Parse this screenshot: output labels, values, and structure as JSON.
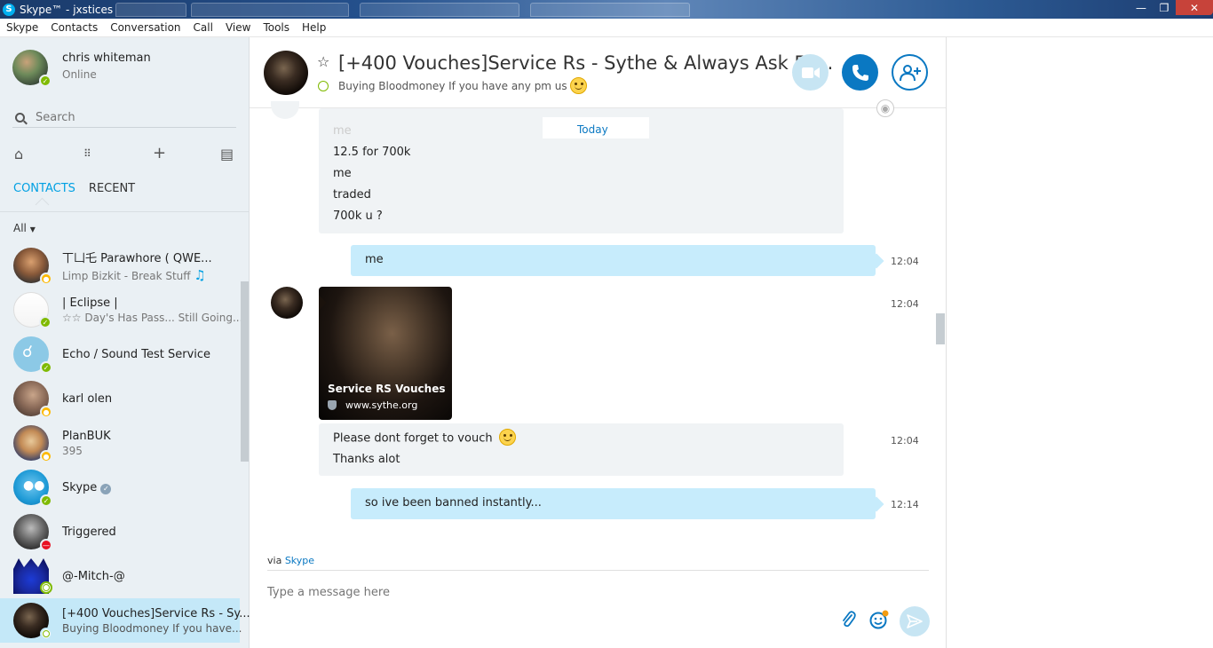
{
  "window": {
    "title": "Skype™ - jxstices"
  },
  "menu": [
    "Skype",
    "Contacts",
    "Conversation",
    "Call",
    "View",
    "Tools",
    "Help"
  ],
  "profile": {
    "name": "chris whiteman",
    "status": "Online"
  },
  "search": {
    "placeholder": "Search"
  },
  "tabs": {
    "contacts": "CONTACTS",
    "recent": "RECENT"
  },
  "filter": {
    "label": "All"
  },
  "contacts": [
    {
      "name": "丅凵乇 Parawhore ( QWE...",
      "sub": "Limp Bizkit - Break Stuff",
      "presence": "away"
    },
    {
      "name": "| Eclipse |",
      "sub": "☆☆ Day's Has Pass... Still Going...",
      "presence": "online"
    },
    {
      "name": "Echo / Sound Test Service",
      "sub": "",
      "presence": "online"
    },
    {
      "name": "karl olen",
      "sub": "",
      "presence": "away"
    },
    {
      "name": "PlanBUK",
      "sub": "395",
      "presence": "away"
    },
    {
      "name": "Skype",
      "sub": "",
      "presence": "online"
    },
    {
      "name": "Triggered",
      "sub": "",
      "presence": "dnd"
    },
    {
      "name": "@-Mitch-@",
      "sub": "",
      "presence": "offline"
    },
    {
      "name": "[+400 Vouches]Service Rs - Sy...",
      "sub": "Buying Bloodmoney If you have...",
      "presence": "offline"
    }
  ],
  "conversation": {
    "title": "[+400 Vouches]Service Rs - Sythe & Always Ask Fo...",
    "mood": "Buying Bloodmoney If you have any pm us",
    "day_separator": "Today",
    "messages": {
      "block1_partial": "me",
      "block1_lines": [
        "12.5 for 700k",
        "me",
        "traded",
        "700k u ?"
      ],
      "out1": {
        "text": "me",
        "time": "12:04"
      },
      "card": {
        "time": "12:04",
        "title": "Service RS Vouches",
        "url": "www.sythe.org"
      },
      "in2_lines": [
        "Please dont forget to vouch",
        "Thanks alot"
      ],
      "in2_time": "12:04",
      "out2": {
        "text": "so ive been banned instantly...",
        "time": "12:14"
      }
    },
    "via_prefix": "via",
    "via_link": "Skype",
    "compose_placeholder": "Type a message here"
  },
  "colors": {
    "accent": "#00a0e3",
    "call_button": "#0a78c2",
    "outgoing_bubble": "#c7ecfc",
    "incoming_bubble": "#f0f3f5",
    "sidebar_bg": "#eaf0f4",
    "selected_contact": "#c4e8f8"
  }
}
